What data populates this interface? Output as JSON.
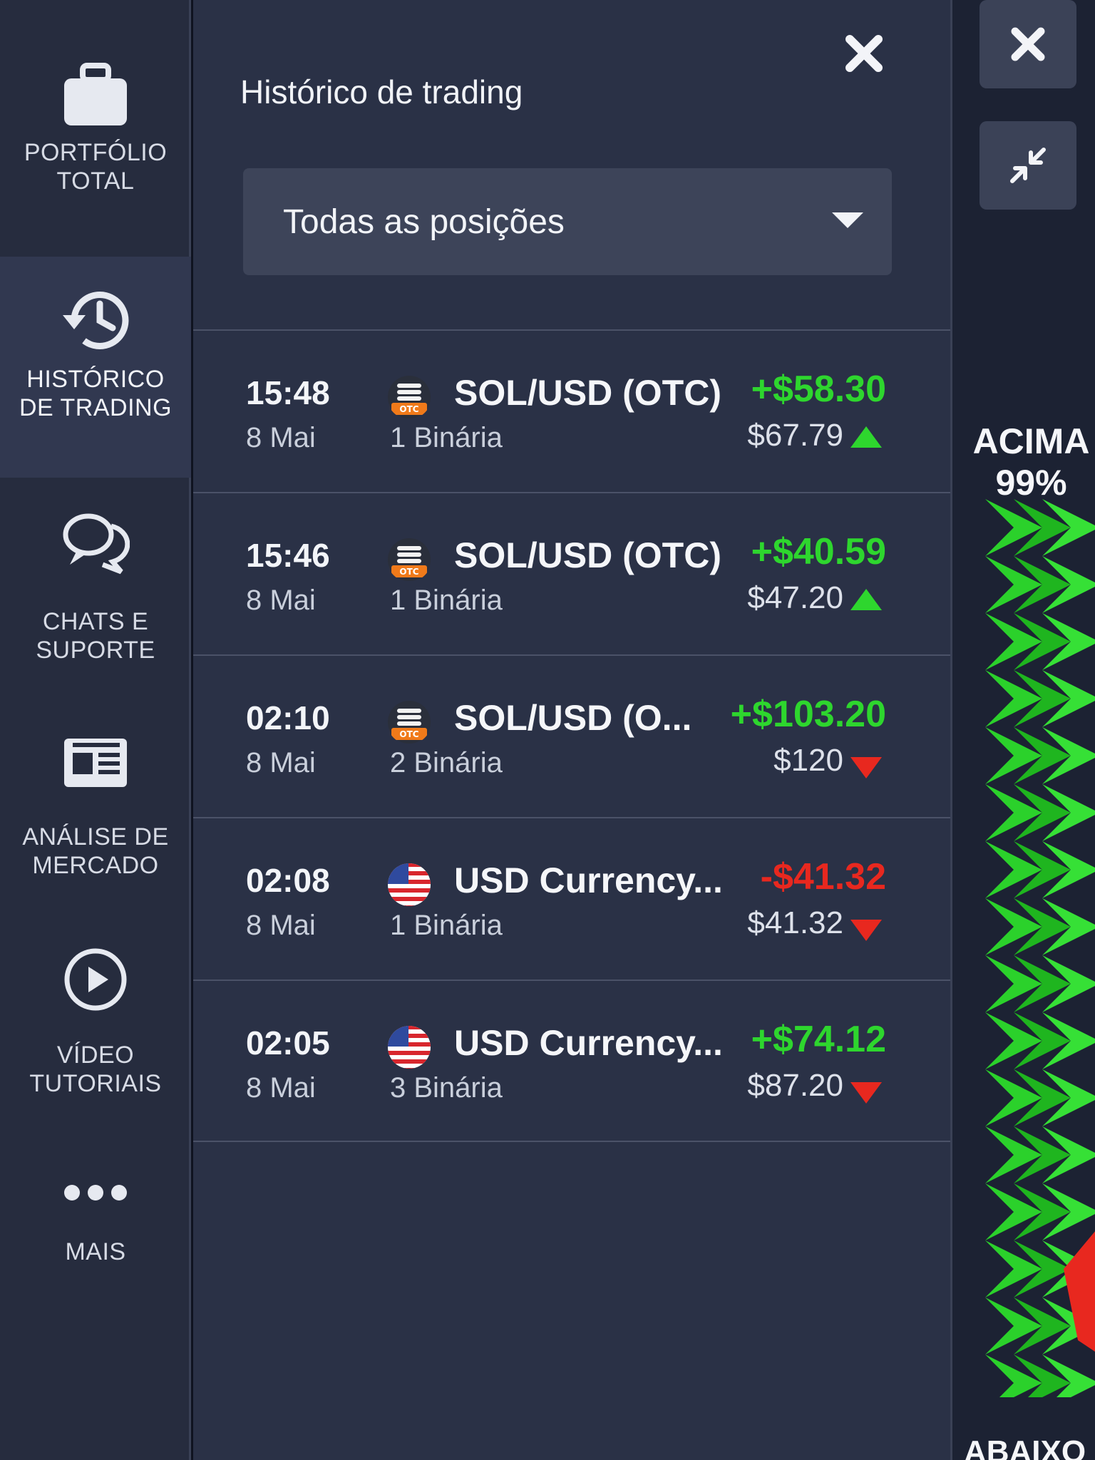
{
  "sidebar": {
    "items": [
      {
        "label": "PORTFÓLIO\nTOTAL",
        "icon": "briefcase-icon"
      },
      {
        "label": "HISTÓRICO\nDE TRADING",
        "icon": "history-icon"
      },
      {
        "label": "CHATS E\nSUPORTE",
        "icon": "chat-icon"
      },
      {
        "label": "ANÁLISE DE\nMERCADO",
        "icon": "newspaper-icon"
      },
      {
        "label": "VÍDEO\nTUTORIAIS",
        "icon": "play-icon"
      },
      {
        "label": "MAIS",
        "icon": "more-icon"
      }
    ]
  },
  "panel": {
    "title": "Histórico de trading",
    "filter_value": "Todas as posições"
  },
  "trades": [
    {
      "time": "15:48",
      "date": "8 Mai",
      "asset": "SOL/USD (OTC)",
      "count": "1 Binária",
      "pnl": "+$58.30",
      "amount": "$67.79",
      "direction": "up",
      "icon": "otc-coin-icon"
    },
    {
      "time": "15:46",
      "date": "8 Mai",
      "asset": "SOL/USD (OTC)",
      "count": "1 Binária",
      "pnl": "+$40.59",
      "amount": "$47.20",
      "direction": "up",
      "icon": "otc-coin-icon"
    },
    {
      "time": "02:10",
      "date": "8 Mai",
      "asset": "SOL/USD (O...",
      "count": "2 Binária",
      "pnl": "+$103.20",
      "amount": "$120",
      "direction": "down",
      "icon": "otc-coin-icon"
    },
    {
      "time": "02:08",
      "date": "8 Mai",
      "asset": "USD Currency...",
      "count": "1 Binária",
      "pnl": "-$41.32",
      "amount": "$41.32",
      "direction": "down",
      "icon": "us-flag-icon"
    },
    {
      "time": "02:05",
      "date": "8 Mai",
      "asset": "USD Currency...",
      "count": "3 Binária",
      "pnl": "+$74.12",
      "amount": "$87.20",
      "direction": "down",
      "icon": "us-flag-icon"
    }
  ],
  "right_strip": {
    "up_label": "ACIMA",
    "up_percent": "99%",
    "down_label": "ABAIXO"
  },
  "colors": {
    "profit": "#2ed62e",
    "loss": "#e8281f"
  }
}
